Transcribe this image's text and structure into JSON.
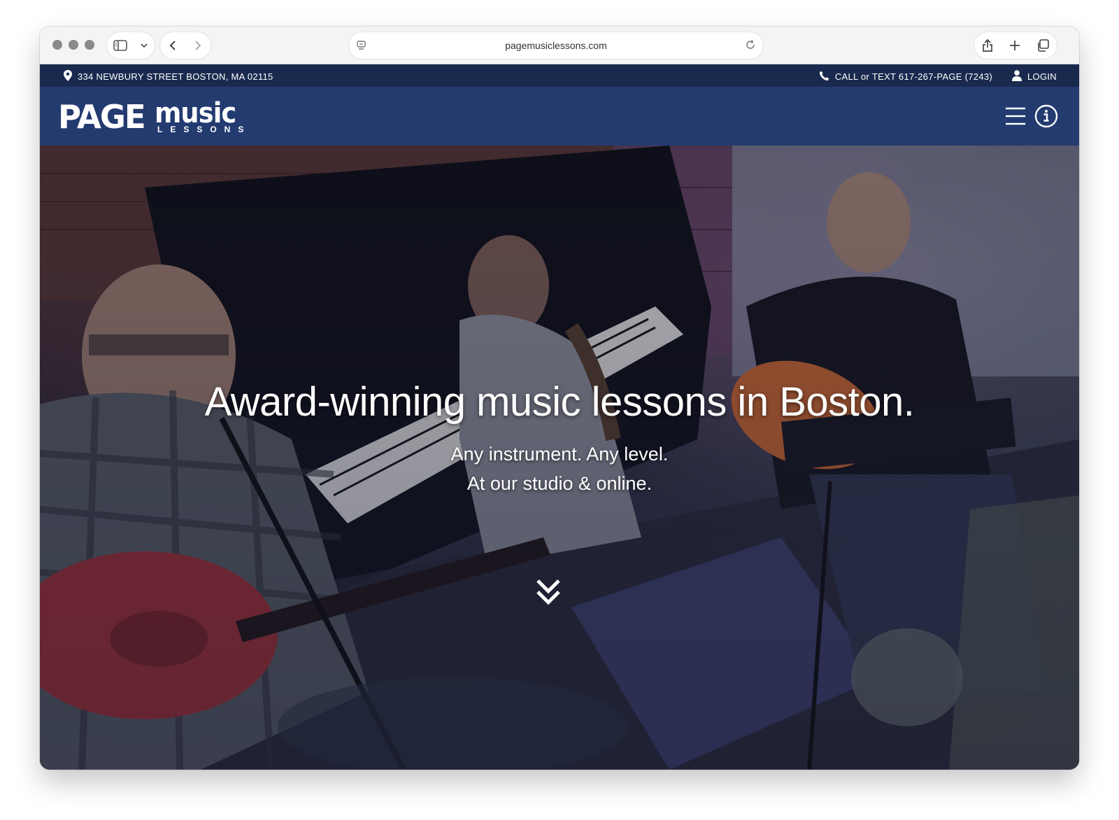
{
  "browser": {
    "url": "pagemusiclessons.com"
  },
  "infobar": {
    "address": "334 NEWBURY STREET BOSTON, MA 02115",
    "phone": "CALL or TEXT 617-267-PAGE (7243)",
    "login": "LOGIN"
  },
  "logo": {
    "page": "PAGE",
    "music": "music",
    "lessons": "LESSONS"
  },
  "hero": {
    "headline": "Award-winning music lessons in Boston.",
    "line1": "Any instrument. Any level.",
    "line2": "At our studio & online."
  },
  "colors": {
    "infobar": "#1a2a4f",
    "navbar": "#243b70",
    "text": "#ffffff"
  },
  "icons": [
    "sidebar-icon",
    "chevron-down-icon",
    "back-icon",
    "forward-icon",
    "site-settings-icon",
    "reload-icon",
    "share-icon",
    "new-tab-icon",
    "tabs-overview-icon",
    "location-pin-icon",
    "phone-icon",
    "user-icon",
    "hamburger-menu-icon",
    "info-icon",
    "double-chevron-down-icon"
  ]
}
